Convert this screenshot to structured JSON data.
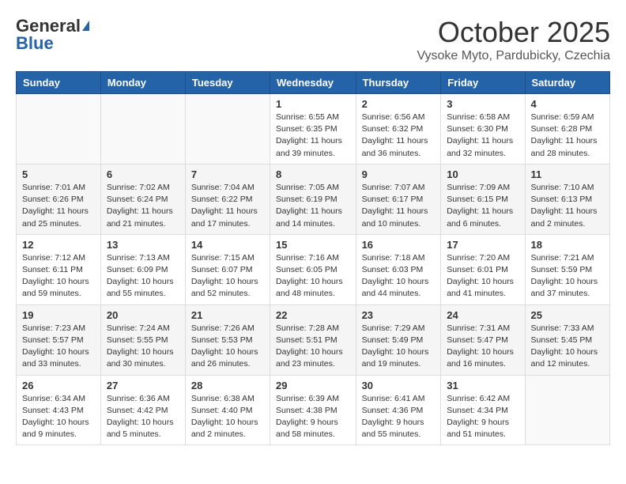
{
  "header": {
    "logo_general": "General",
    "logo_blue": "Blue",
    "month_title": "October 2025",
    "location": "Vysoke Myto, Pardubicky, Czechia"
  },
  "weekdays": [
    "Sunday",
    "Monday",
    "Tuesday",
    "Wednesday",
    "Thursday",
    "Friday",
    "Saturday"
  ],
  "weeks": [
    [
      {
        "day": "",
        "info": ""
      },
      {
        "day": "",
        "info": ""
      },
      {
        "day": "",
        "info": ""
      },
      {
        "day": "1",
        "info": "Sunrise: 6:55 AM\nSunset: 6:35 PM\nDaylight: 11 hours\nand 39 minutes."
      },
      {
        "day": "2",
        "info": "Sunrise: 6:56 AM\nSunset: 6:32 PM\nDaylight: 11 hours\nand 36 minutes."
      },
      {
        "day": "3",
        "info": "Sunrise: 6:58 AM\nSunset: 6:30 PM\nDaylight: 11 hours\nand 32 minutes."
      },
      {
        "day": "4",
        "info": "Sunrise: 6:59 AM\nSunset: 6:28 PM\nDaylight: 11 hours\nand 28 minutes."
      }
    ],
    [
      {
        "day": "5",
        "info": "Sunrise: 7:01 AM\nSunset: 6:26 PM\nDaylight: 11 hours\nand 25 minutes."
      },
      {
        "day": "6",
        "info": "Sunrise: 7:02 AM\nSunset: 6:24 PM\nDaylight: 11 hours\nand 21 minutes."
      },
      {
        "day": "7",
        "info": "Sunrise: 7:04 AM\nSunset: 6:22 PM\nDaylight: 11 hours\nand 17 minutes."
      },
      {
        "day": "8",
        "info": "Sunrise: 7:05 AM\nSunset: 6:19 PM\nDaylight: 11 hours\nand 14 minutes."
      },
      {
        "day": "9",
        "info": "Sunrise: 7:07 AM\nSunset: 6:17 PM\nDaylight: 11 hours\nand 10 minutes."
      },
      {
        "day": "10",
        "info": "Sunrise: 7:09 AM\nSunset: 6:15 PM\nDaylight: 11 hours\nand 6 minutes."
      },
      {
        "day": "11",
        "info": "Sunrise: 7:10 AM\nSunset: 6:13 PM\nDaylight: 11 hours\nand 2 minutes."
      }
    ],
    [
      {
        "day": "12",
        "info": "Sunrise: 7:12 AM\nSunset: 6:11 PM\nDaylight: 10 hours\nand 59 minutes."
      },
      {
        "day": "13",
        "info": "Sunrise: 7:13 AM\nSunset: 6:09 PM\nDaylight: 10 hours\nand 55 minutes."
      },
      {
        "day": "14",
        "info": "Sunrise: 7:15 AM\nSunset: 6:07 PM\nDaylight: 10 hours\nand 52 minutes."
      },
      {
        "day": "15",
        "info": "Sunrise: 7:16 AM\nSunset: 6:05 PM\nDaylight: 10 hours\nand 48 minutes."
      },
      {
        "day": "16",
        "info": "Sunrise: 7:18 AM\nSunset: 6:03 PM\nDaylight: 10 hours\nand 44 minutes."
      },
      {
        "day": "17",
        "info": "Sunrise: 7:20 AM\nSunset: 6:01 PM\nDaylight: 10 hours\nand 41 minutes."
      },
      {
        "day": "18",
        "info": "Sunrise: 7:21 AM\nSunset: 5:59 PM\nDaylight: 10 hours\nand 37 minutes."
      }
    ],
    [
      {
        "day": "19",
        "info": "Sunrise: 7:23 AM\nSunset: 5:57 PM\nDaylight: 10 hours\nand 33 minutes."
      },
      {
        "day": "20",
        "info": "Sunrise: 7:24 AM\nSunset: 5:55 PM\nDaylight: 10 hours\nand 30 minutes."
      },
      {
        "day": "21",
        "info": "Sunrise: 7:26 AM\nSunset: 5:53 PM\nDaylight: 10 hours\nand 26 minutes."
      },
      {
        "day": "22",
        "info": "Sunrise: 7:28 AM\nSunset: 5:51 PM\nDaylight: 10 hours\nand 23 minutes."
      },
      {
        "day": "23",
        "info": "Sunrise: 7:29 AM\nSunset: 5:49 PM\nDaylight: 10 hours\nand 19 minutes."
      },
      {
        "day": "24",
        "info": "Sunrise: 7:31 AM\nSunset: 5:47 PM\nDaylight: 10 hours\nand 16 minutes."
      },
      {
        "day": "25",
        "info": "Sunrise: 7:33 AM\nSunset: 5:45 PM\nDaylight: 10 hours\nand 12 minutes."
      }
    ],
    [
      {
        "day": "26",
        "info": "Sunrise: 6:34 AM\nSunset: 4:43 PM\nDaylight: 10 hours\nand 9 minutes."
      },
      {
        "day": "27",
        "info": "Sunrise: 6:36 AM\nSunset: 4:42 PM\nDaylight: 10 hours\nand 5 minutes."
      },
      {
        "day": "28",
        "info": "Sunrise: 6:38 AM\nSunset: 4:40 PM\nDaylight: 10 hours\nand 2 minutes."
      },
      {
        "day": "29",
        "info": "Sunrise: 6:39 AM\nSunset: 4:38 PM\nDaylight: 9 hours\nand 58 minutes."
      },
      {
        "day": "30",
        "info": "Sunrise: 6:41 AM\nSunset: 4:36 PM\nDaylight: 9 hours\nand 55 minutes."
      },
      {
        "day": "31",
        "info": "Sunrise: 6:42 AM\nSunset: 4:34 PM\nDaylight: 9 hours\nand 51 minutes."
      },
      {
        "day": "",
        "info": ""
      }
    ]
  ]
}
